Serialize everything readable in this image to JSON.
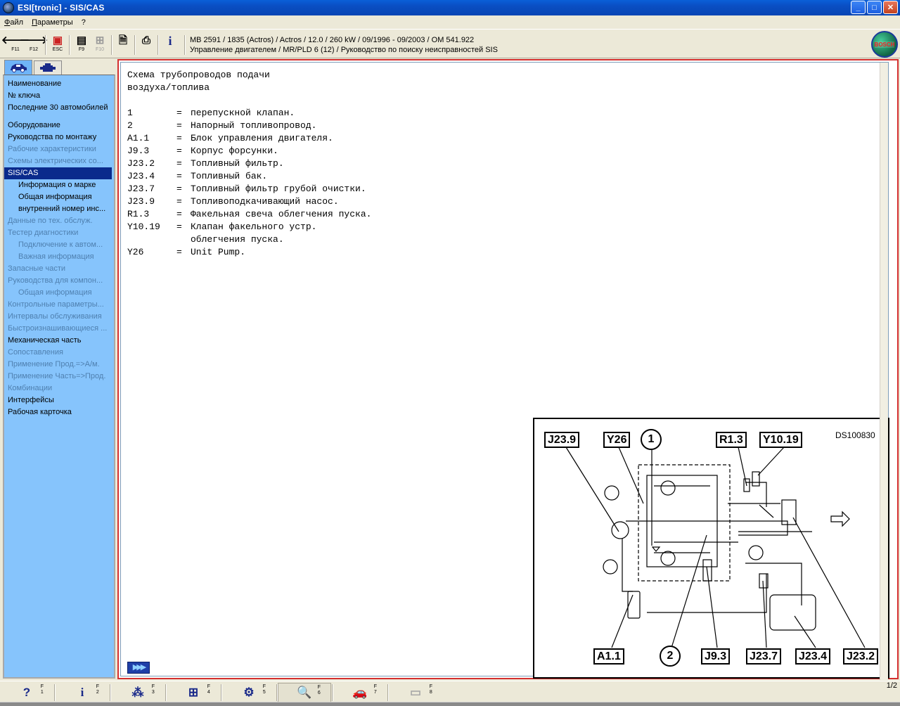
{
  "window": {
    "title": "ESI[tronic] - SIS/CAS",
    "buttons": [
      "_",
      "□",
      "✕"
    ]
  },
  "menu": [
    "Файл",
    "Параметры",
    "?"
  ],
  "toolbar": {
    "buttons": [
      {
        "name": "back",
        "glyph": "🡐",
        "key": "F11",
        "enabled": true
      },
      {
        "name": "forward",
        "glyph": "🡒",
        "key": "F12",
        "enabled": true
      },
      {
        "name": "escape",
        "glyph": "▣",
        "key": "ESC",
        "enabled": true
      },
      {
        "name": "f9",
        "glyph": "▤",
        "key": "F9",
        "enabled": true
      },
      {
        "name": "f10",
        "glyph": "⊞",
        "key": "F10",
        "enabled": false
      },
      {
        "name": "document",
        "glyph": "🗎",
        "key": "",
        "enabled": true
      },
      {
        "name": "print",
        "glyph": "⎙",
        "key": "",
        "enabled": true
      },
      {
        "name": "info",
        "glyph": "i",
        "key": "",
        "enabled": true
      }
    ],
    "vehicle_line1": "MB 2591 / 1835 (Actros) / Actros / 12.0 / 260 kW / 09/1996 - 09/2003 / OM 541.922",
    "vehicle_line2": "Управление двигателем / MR/PLD 6 (12) / Руководство по поиску неисправностей SIS",
    "logo_text": "BOSCH"
  },
  "sidebar": {
    "items": [
      {
        "label": "Наименование",
        "style": "normal"
      },
      {
        "label": "№ ключа",
        "style": "normal"
      },
      {
        "label": "Последние 30 автомобилей",
        "style": "normal"
      },
      {
        "label": "Оборудование",
        "style": "gap"
      },
      {
        "label": "Руководства по монтажу",
        "style": "normal"
      },
      {
        "label": "Рабочие характеристики",
        "style": "dim"
      },
      {
        "label": "Схемы электрических со...",
        "style": "dim"
      },
      {
        "label": "SIS/CAS",
        "style": "selected"
      },
      {
        "label": "Информация о марке",
        "style": "indent"
      },
      {
        "label": "Общая информация",
        "style": "indent"
      },
      {
        "label": "внутренний номер инс...",
        "style": "indent"
      },
      {
        "label": "Данные по тех. обслуж.",
        "style": "dim"
      },
      {
        "label": "Тестер диагностики",
        "style": "dim"
      },
      {
        "label": "Подключение к автом...",
        "style": "dim-indent"
      },
      {
        "label": "Важная информация",
        "style": "dim-indent"
      },
      {
        "label": "Запасные части",
        "style": "dim"
      },
      {
        "label": "Руководства для компон...",
        "style": "dim"
      },
      {
        "label": "Общая информация",
        "style": "dim-indent"
      },
      {
        "label": "Контрольные параметры...",
        "style": "dim"
      },
      {
        "label": "Интервалы обслуживания",
        "style": "dim"
      },
      {
        "label": "Быстроизнашивающиеся ...",
        "style": "dim"
      },
      {
        "label": "Механическая часть",
        "style": "normal"
      },
      {
        "label": "Сопоставления",
        "style": "dim"
      },
      {
        "label": "Применение Прод.=>А/м.",
        "style": "dim"
      },
      {
        "label": "Применение Часть=>Прод.",
        "style": "dim"
      },
      {
        "label": "Комбинации",
        "style": "dim"
      },
      {
        "label": "Интерфейсы",
        "style": "normal"
      },
      {
        "label": "Рабочая карточка",
        "style": "normal"
      }
    ]
  },
  "document": {
    "title_line1": "Схема трубопроводов подачи",
    "title_line2": "воздуха/топлива",
    "legend": [
      {
        "code": "1",
        "text": "перепускной клапан."
      },
      {
        "code": "2",
        "text": "Напорный топливопровод."
      },
      {
        "code": "A1.1",
        "text": "Блок управления двигателя."
      },
      {
        "code": "J9.3",
        "text": "Корпус форсунки."
      },
      {
        "code": "J23.2",
        "text": "Топливный фильтр."
      },
      {
        "code": "J23.4",
        "text": "Топливный бак."
      },
      {
        "code": "J23.7",
        "text": "Топливный фильтр грубой очистки."
      },
      {
        "code": "J23.9",
        "text": "Топливоподкачивающий насос."
      },
      {
        "code": "R1.3",
        "text": "Факельная свеча облегчения пуска."
      },
      {
        "code": "Y10.19",
        "text": "Клапан факельного устр."
      },
      {
        "code": "",
        "text": "облегчения пуска."
      },
      {
        "code": "Y26",
        "text": "Unit Pump."
      }
    ],
    "next_button": "▶▶▶"
  },
  "diagram": {
    "id": "DS100830",
    "callouts_top": [
      "J23.9",
      "Y26",
      "1",
      "R1.3",
      "Y10.19"
    ],
    "callouts_bottom": [
      "A1.1",
      "2",
      "J9.3",
      "J23.7",
      "J23.4",
      "J23.2"
    ]
  },
  "bottombar": {
    "buttons": [
      {
        "name": "help",
        "glyph": "?",
        "key": "F\n1",
        "enabled": true
      },
      {
        "name": "info",
        "glyph": "i",
        "key": "F\n2",
        "enabled": true
      },
      {
        "name": "f3",
        "glyph": "⁂",
        "key": "F\n3",
        "enabled": true
      },
      {
        "name": "f4",
        "glyph": "⊞",
        "key": "F\n4",
        "enabled": true
      },
      {
        "name": "f5",
        "glyph": "⚙",
        "key": "F\n5",
        "enabled": true
      },
      {
        "name": "zoom",
        "glyph": "🔍",
        "key": "F\n6",
        "enabled": true
      },
      {
        "name": "vehicle",
        "glyph": "🚗",
        "key": "F\n7",
        "enabled": true
      },
      {
        "name": "f8",
        "glyph": "▭",
        "key": "F\n8",
        "enabled": false
      }
    ],
    "page_count": "1/2"
  },
  "colors": {
    "sidebar_bg": "#86c4fc",
    "selected_bg": "#0a2a8c",
    "frame_red": "#d43030",
    "titlebar": "#0a4ec2"
  }
}
